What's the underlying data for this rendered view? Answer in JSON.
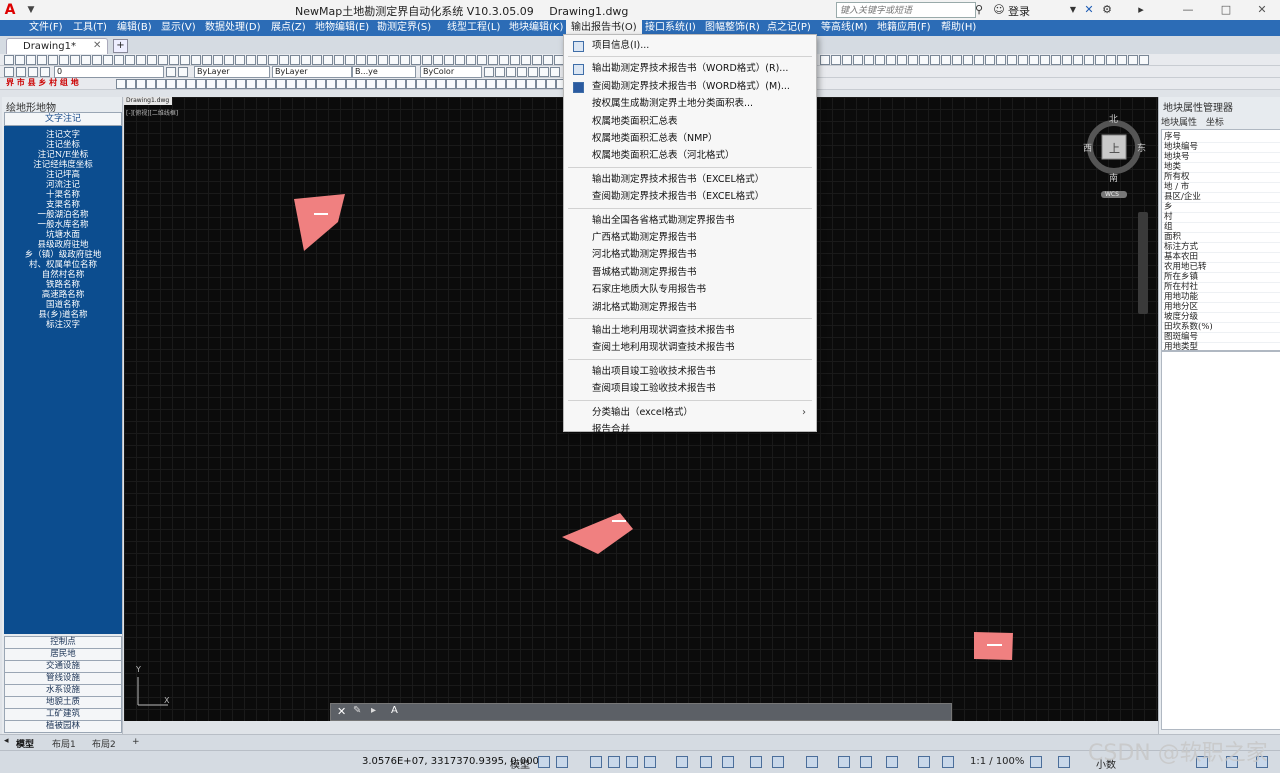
{
  "titlebar": {
    "app_title": "NewMap土地勘测定界自动化系统 V10.3.05.09",
    "document": "Drawing1.dwg",
    "search_placeholder": "键入关键字或短语",
    "login": "登录"
  },
  "menubar": [
    "文件(F)",
    "工具(T)",
    "编辑(B)",
    "显示(V)",
    "数据处理(D)",
    "展点(Z)",
    "地物编辑(E)",
    "勘测定界(S)",
    "线型工程(L)",
    "地块编辑(K)",
    "输出报告书(O)",
    "接口系统(I)",
    "图幅整饰(R)",
    "点之记(P)",
    "等高线(M)",
    "地籍应用(F)",
    "帮助(H)"
  ],
  "active_menu": "输出报告书(O)",
  "doc_tab": "Drawing1*",
  "toolbar": {
    "layer_value": "0",
    "linetype1": "ByLayer",
    "linetype2": "ByLayer",
    "lineweight": "B...ye",
    "color": "ByColor",
    "categories": "界 市 县 乡 村 组 地"
  },
  "left_panel": {
    "title": "绘地形地物",
    "tab": "文字注记",
    "items": [
      "注记文字",
      "注记坐标",
      "注记N/E坐标",
      "注记经纬度坐标",
      "注记坪高",
      "河流注记",
      "十渠名称",
      "支渠名称",
      "一般湖泊名称",
      "一般水库名称",
      "坑塘水面",
      "县级政府驻地",
      "乡（镇）级政府驻地",
      "村、权属单位名称",
      "自然村名称",
      "铁路名称",
      "高速路名称",
      "国道名称",
      "县(乡)道名称",
      "标注汉字"
    ],
    "bottom": [
      "控制点",
      "居民地",
      "交通设施",
      "管线设施",
      "水系设施",
      "地貌土质",
      "工矿建筑",
      "植被园林"
    ]
  },
  "canvas": {
    "tab": "Drawing1.dwg",
    "view_label": "[-][俯视][二维线框]",
    "compass": {
      "north": "北",
      "south": "南",
      "east": "东",
      "west": "西",
      "top": "上",
      "wcs": "WCS"
    },
    "ucs": {
      "x": "X",
      "y": "Y"
    },
    "command_prefix": "A"
  },
  "dropdown": {
    "groups": [
      [
        {
          "label": "项目信息(I)...",
          "icon": "info-icon"
        }
      ],
      [
        {
          "label": "输出勘测定界技术报告书（WORD格式）(R)...",
          "icon": "word-export-icon"
        },
        {
          "label": "查阅勘测定界技术报告书（WORD格式）(M)...",
          "icon": "word-view-icon"
        },
        {
          "label": "按权属生成勘测定界土地分类面积表..."
        },
        {
          "label": "权属地类面积汇总表"
        },
        {
          "label": "权属地类面积汇总表（NMP）"
        },
        {
          "label": "权属地类面积汇总表（河北格式）"
        }
      ],
      [
        {
          "label": "输出勘测定界技术报告书（EXCEL格式）"
        },
        {
          "label": "查阅勘测定界技术报告书（EXCEL格式）"
        }
      ],
      [
        {
          "label": "输出全国各省格式勘测定界报告书"
        },
        {
          "label": "广西格式勘测定界报告书"
        },
        {
          "label": "河北格式勘测定界报告书"
        },
        {
          "label": "晋城格式勘测定界报告书"
        },
        {
          "label": "石家庄地质大队专用报告书"
        },
        {
          "label": "湖北格式勘测定界报告书"
        }
      ],
      [
        {
          "label": "输出土地利用现状调查技术报告书"
        },
        {
          "label": "查阅土地利用现状调查技术报告书"
        }
      ],
      [
        {
          "label": "输出项目竣工验收技术报告书"
        },
        {
          "label": "查阅项目竣工验收技术报告书"
        }
      ],
      [
        {
          "label": "分类输出（excel格式）",
          "submenu": true
        },
        {
          "label": "报告合并"
        }
      ]
    ]
  },
  "right_panel": {
    "title": "地块属性管理器",
    "tabs": [
      "地块属性",
      "坐标"
    ],
    "properties": [
      "序号",
      "地块编号",
      "地块号",
      "地类",
      "所有权",
      "地 / 市",
      "县区/企业",
      "乡",
      "村",
      "组",
      "面积",
      "标注方式",
      "基本农田",
      "农用地已转",
      "所在乡镇",
      "所在村社",
      "用地功能",
      "用地分区",
      "坡度分级",
      "田坎系数(%)",
      "图斑编号",
      "用地类型"
    ]
  },
  "layout_tabs": [
    "模型",
    "布局1",
    "布局2"
  ],
  "statusbar": {
    "coords": "3.0576E+07, 3317370.9395, 0.0000",
    "model": "模型",
    "zoom": "1:1 / 100%",
    "units": "小数",
    "watermark": "CSDN @软职之家"
  },
  "colors": {
    "menubar": "#2c6cb6",
    "left_list": "#0c4d8f",
    "parcel": "#f08080",
    "canvas": "#0b0b0b"
  }
}
